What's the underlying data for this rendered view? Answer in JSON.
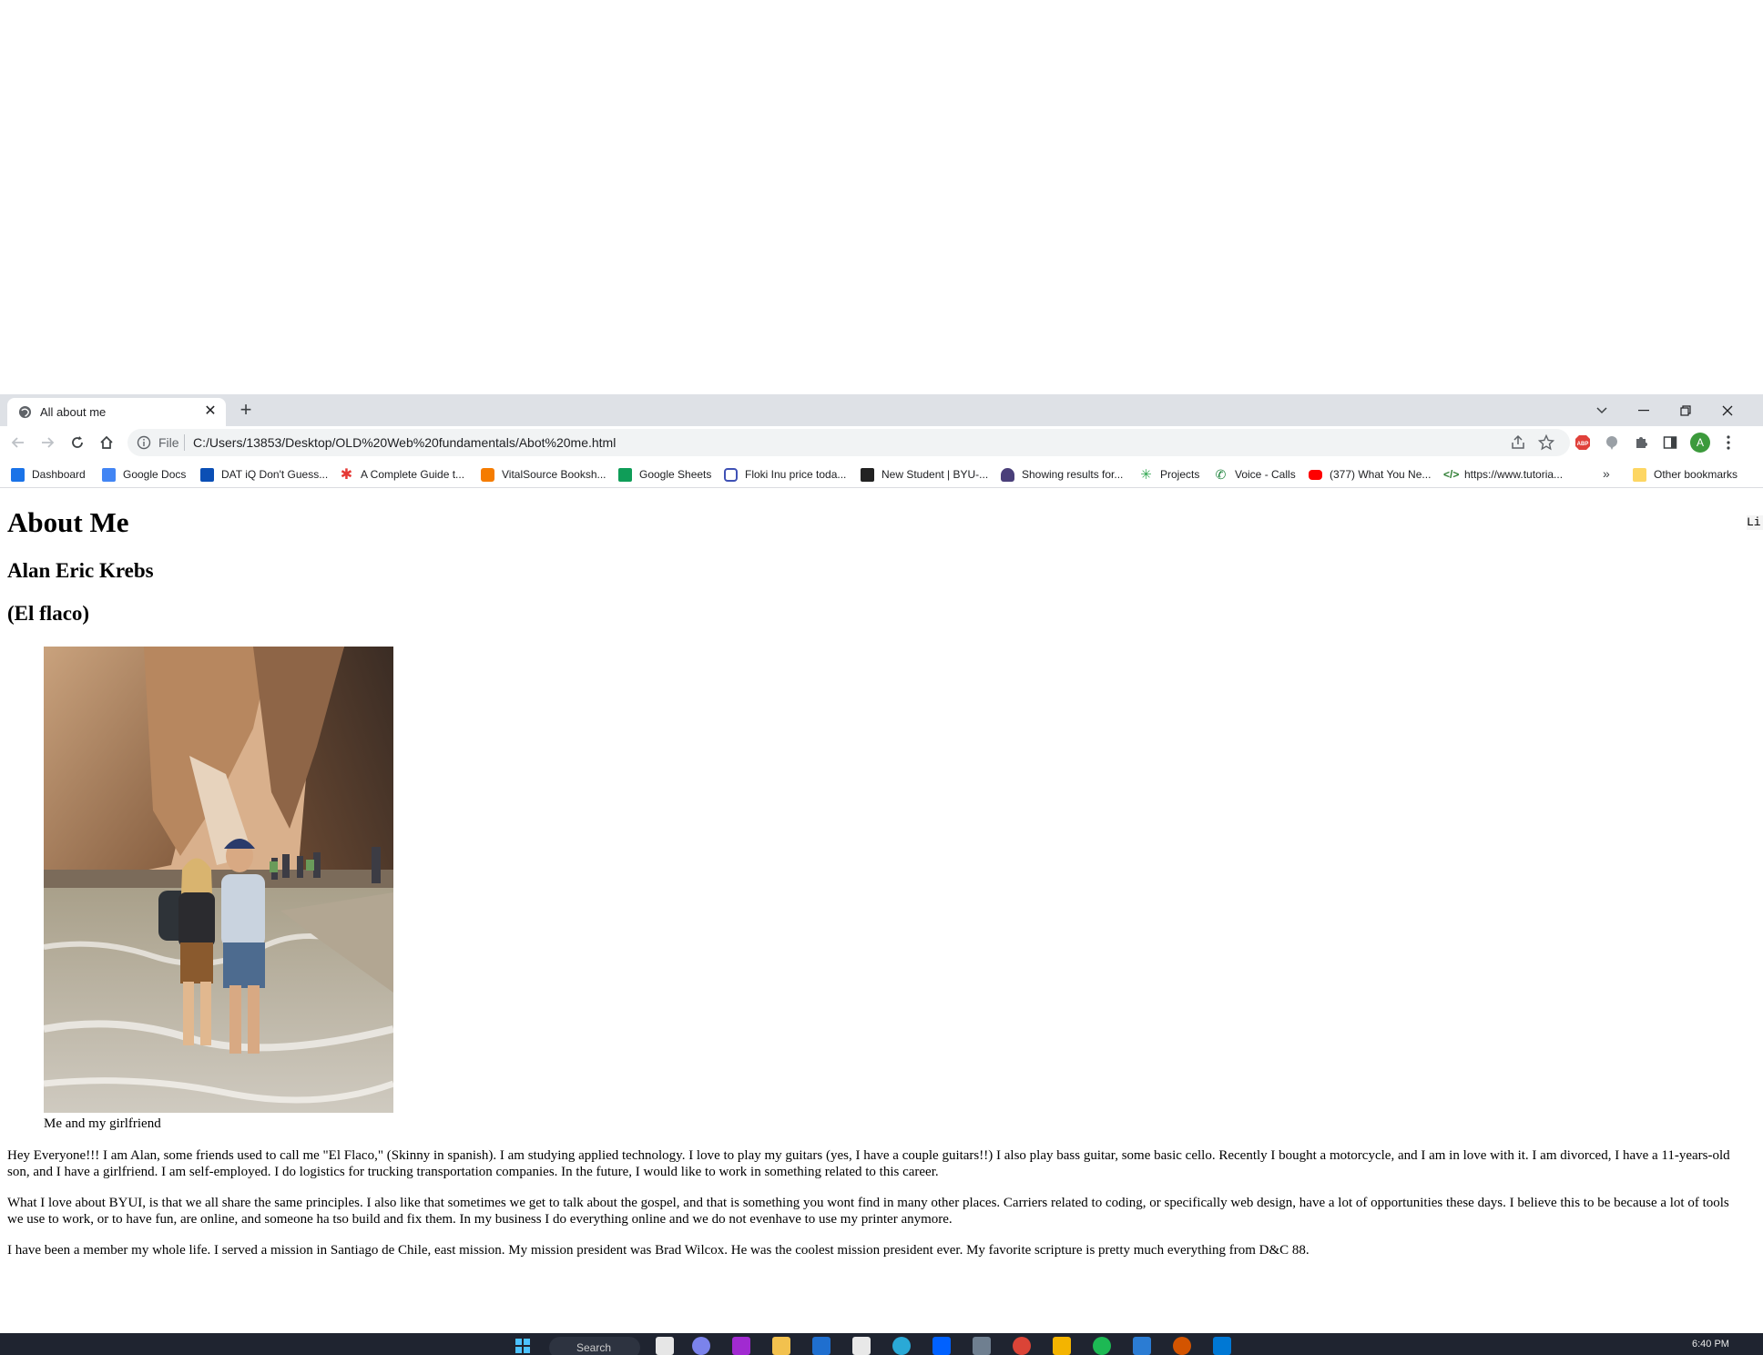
{
  "browser": {
    "tab": {
      "title": "All about me"
    },
    "omnibox": {
      "scheme": "File",
      "url": "C:/Users/13853/Desktop/OLD%20Web%20fundamentals/Abot%20me.html"
    },
    "profile_initial": "A",
    "bookmarks": [
      {
        "label": "Dashboard",
        "icon": "dashboard-icon",
        "color": "#1a73e8"
      },
      {
        "label": "Google Docs",
        "icon": "docs-icon",
        "color": "#4285f4"
      },
      {
        "label": "DAT iQ Don't Guess...",
        "icon": "dat-icon",
        "color": "#0b4fb5"
      },
      {
        "label": "A Complete Guide t...",
        "icon": "asterisk-icon",
        "color": "#e53935"
      },
      {
        "label": "VitalSource Booksh...",
        "icon": "vitalsource-icon",
        "color": "#f57c00"
      },
      {
        "label": "Google Sheets",
        "icon": "sheets-icon",
        "color": "#0f9d58"
      },
      {
        "label": "Floki Inu price toda...",
        "icon": "coin-icon",
        "color": "#3f51b5"
      },
      {
        "label": "New Student | BYU-...",
        "icon": "byu-icon",
        "color": "#222222"
      },
      {
        "label": "Showing results for...",
        "icon": "wolf-icon",
        "color": "#4a3f7a"
      },
      {
        "label": "Projects",
        "icon": "projects-icon",
        "color": "#34a853"
      },
      {
        "label": "Voice - Calls",
        "icon": "phone-icon",
        "color": "#188038"
      },
      {
        "label": "(377) What You Ne...",
        "icon": "youtube-icon",
        "color": "#ff0000"
      },
      {
        "label": "https://www.tutoria...",
        "icon": "code-icon",
        "color": "#2e7d32"
      }
    ],
    "other_bookmarks": "Other bookmarks"
  },
  "page": {
    "heading": "About Me",
    "name": "Alan Eric Krebs",
    "nickname": "(El flaco)",
    "caption": "Me and my girlfriend",
    "paragraphs": [
      "Hey Everyone!!! I am Alan, some friends used to call me \"El Flaco,\" (Skinny in spanish). I am studying applied technology. I love to play my guitars (yes, I have a couple guitars!!) I also play bass guitar, some basic cello. Recently I bought a motorcycle, and I am in love with it. I am divorced, I have a 11-years-old son, and I have a girlfriend. I am self-employed. I do logistics for trucking transportation companies. In the future, I would like to work in something related to this career.",
      "What I love about BYUI, is that we all share the same principles. I also like that sometimes we get to talk about the gospel, and that is something you wont find in many other places. Carriers related to coding, or specifically web design, have a lot of opportunities these days. I believe this to be because a lot of tools we use to work, or to have fun, are online, and someone ha tso build and fix them. In my business I do everything online and we do not evenhave to use my printer anymore.",
      "I have been a member my whole life. I served a mission in Santiago de Chile, east mission. My mission president was Brad Wilcox. He was the coolest mission president ever. My favorite scripture is pretty much everything from D&C 88."
    ],
    "edge_text": "Li"
  },
  "taskbar": {
    "search": "Search",
    "clock": "6:40 PM"
  }
}
